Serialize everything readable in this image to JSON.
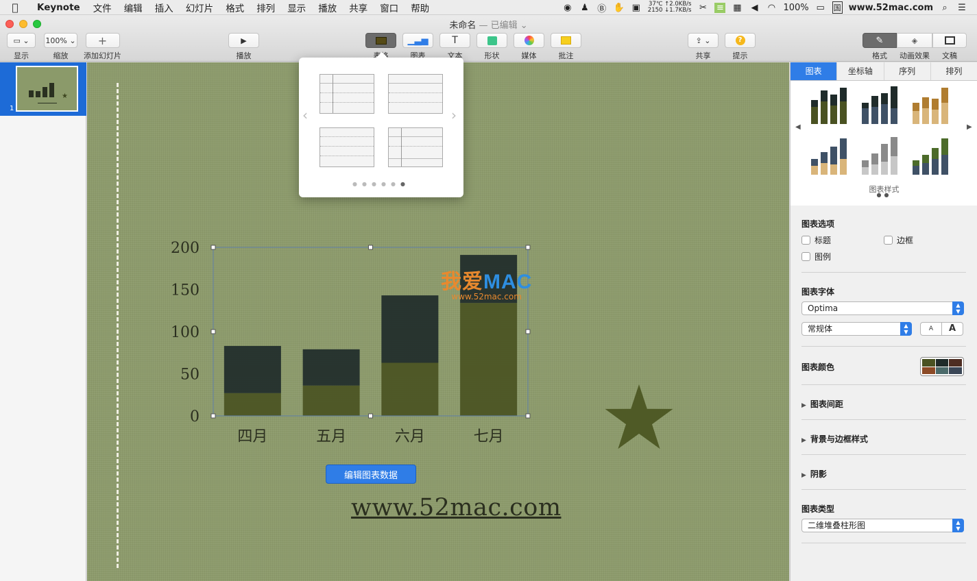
{
  "menubar": {
    "app_name": "Keynote",
    "menus": [
      "文件",
      "编辑",
      "插入",
      "幻灯片",
      "格式",
      "排列",
      "显示",
      "播放",
      "共享",
      "窗口",
      "帮助"
    ],
    "net_line1": "37℃ ↑2.0KB/s",
    "net_line2": "2150 ↓1.7KB/s",
    "battery": "100%",
    "input_method": "国",
    "site": "www.52mac.com"
  },
  "window": {
    "title": "未命名",
    "edited": "— 已编辑 ⌄"
  },
  "toolbar": {
    "view_label": "显示",
    "zoom_value": "100%",
    "zoom_label": "缩放",
    "add_slide_label": "添加幻灯片",
    "play_label": "播放",
    "table_label": "表格",
    "chart_label": "图表",
    "text_label": "文本",
    "shape_label": "形状",
    "media_label": "媒体",
    "comment_label": "批注",
    "share_label": "共享",
    "tips_label": "提示",
    "format_label": "格式",
    "animate_label": "动画效果",
    "document_label": "文稿"
  },
  "navigator": {
    "slide_number": "1"
  },
  "chart_data": {
    "type": "bar",
    "stacked": true,
    "categories": [
      "四月",
      "五月",
      "六月",
      "七月"
    ],
    "series": [
      {
        "values": [
          27,
          36,
          63,
          134
        ]
      },
      {
        "values": [
          56,
          43,
          80,
          57
        ]
      }
    ],
    "ylim": [
      0,
      200
    ],
    "yticks": [
      0,
      50,
      100,
      150,
      200
    ],
    "colors": [
      "#4a5222",
      "#1f2b2a"
    ]
  },
  "canvas": {
    "edit_data_button": "编辑图表数据",
    "site_text": "www.52mac.com",
    "watermark_cn": "我爱",
    "watermark_en": "MAC",
    "watermark_url": "www.52mac.com"
  },
  "inspector": {
    "tabs": [
      "图表",
      "坐标轴",
      "序列",
      "排列"
    ],
    "styles_caption": "图表样式",
    "chart_options_label": "图表选项",
    "title_checkbox": "标题",
    "border_checkbox": "边框",
    "legend_checkbox": "图例",
    "chart_font_label": "图表字体",
    "font_name": "Optima",
    "font_style": "常规体",
    "font_small": "A",
    "font_large": "A",
    "chart_colors_label": "图表颜色",
    "gap_label": "图表间距",
    "background_label": "背景与边框样式",
    "shadow_label": "阴影",
    "chart_type_label": "图表类型",
    "chart_type_value": "二维堆叠柱形图"
  }
}
